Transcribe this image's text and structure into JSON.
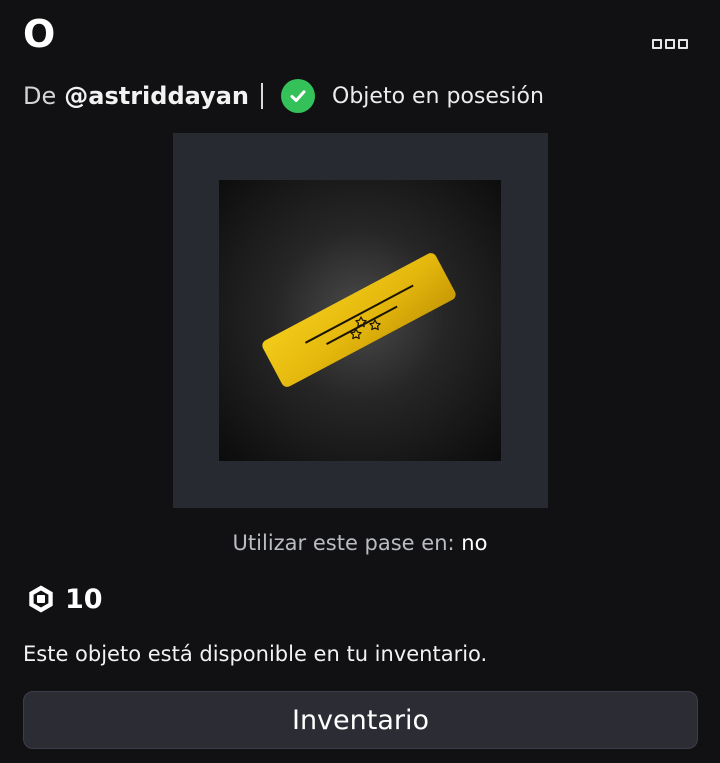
{
  "header": {
    "title": "O",
    "more_icon": "more-options-icon"
  },
  "creator": {
    "prefix": "De",
    "name": "@astriddayan"
  },
  "ownership": {
    "icon": "checkmark-icon",
    "label": "Objeto en posesión",
    "color": "#35c15a"
  },
  "item": {
    "thumbnail_icon": "gold-ticket-pass-icon",
    "use_label": "Utilizar este pase en:",
    "use_value": "no"
  },
  "price": {
    "icon": "robux-icon",
    "value": "10"
  },
  "note": "Este objeto está disponible en tu inventario.",
  "actions": {
    "inventory_label": "Inventario"
  },
  "colors": {
    "background": "#111113",
    "panel": "#272a31",
    "button": "#2c2d34",
    "gold": "#e5b90f"
  }
}
